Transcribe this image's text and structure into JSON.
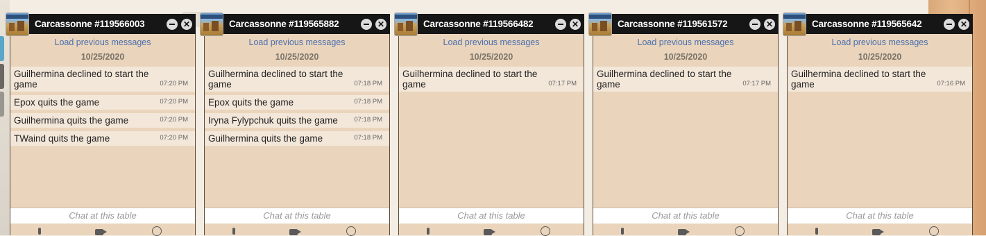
{
  "icons": {
    "minimize": "minimize-icon",
    "close": "close-icon",
    "microphone": "microphone-icon",
    "video": "video-camera-icon",
    "settings": "gear-icon"
  },
  "colors": {
    "header": "#161616",
    "panel": "#ead5bc",
    "message_bg": "#f3e7d9",
    "link": "#4a6fb0"
  },
  "chats": [
    {
      "title": "Carcassonne #119566003",
      "load_previous": "Load previous messages",
      "date": "10/25/2020",
      "messages": [
        {
          "text": "Guilhermina declined to start the game",
          "time": "07:20 PM"
        },
        {
          "text": "Epox quits the game",
          "time": "07:20 PM"
        },
        {
          "text": "Guilhermina quits the game",
          "time": "07:20 PM"
        },
        {
          "text": "TWaind quits the game",
          "time": "07:20 PM"
        }
      ],
      "input_placeholder": "Chat at this table"
    },
    {
      "title": "Carcassonne #119565882",
      "load_previous": "Load previous messages",
      "date": "10/25/2020",
      "messages": [
        {
          "text": "Guilhermina declined to start the game",
          "time": "07:18 PM"
        },
        {
          "text": "Epox quits the game",
          "time": "07:18 PM"
        },
        {
          "text": "Iryna Fylypchuk quits the game",
          "time": "07:18 PM"
        },
        {
          "text": "Guilhermina quits the game",
          "time": "07:18 PM"
        }
      ],
      "input_placeholder": "Chat at this table"
    },
    {
      "title": "Carcassonne #119566482",
      "load_previous": "Load previous messages",
      "date": "10/25/2020",
      "messages": [
        {
          "text": "Guilhermina declined to start the game",
          "time": "07:17 PM"
        }
      ],
      "input_placeholder": "Chat at this table"
    },
    {
      "title": "Carcassonne #119561572",
      "load_previous": "Load previous messages",
      "date": "10/25/2020",
      "messages": [
        {
          "text": "Guilhermina declined to start the game",
          "time": "07:17 PM"
        }
      ],
      "input_placeholder": "Chat at this table"
    },
    {
      "title": "Carcassonne #119565642",
      "load_previous": "Load previous messages",
      "date": "10/25/2020",
      "messages": [
        {
          "text": "Guilhermina declined to start the game",
          "time": "07:16 PM"
        }
      ],
      "input_placeholder": "Chat at this table"
    }
  ]
}
